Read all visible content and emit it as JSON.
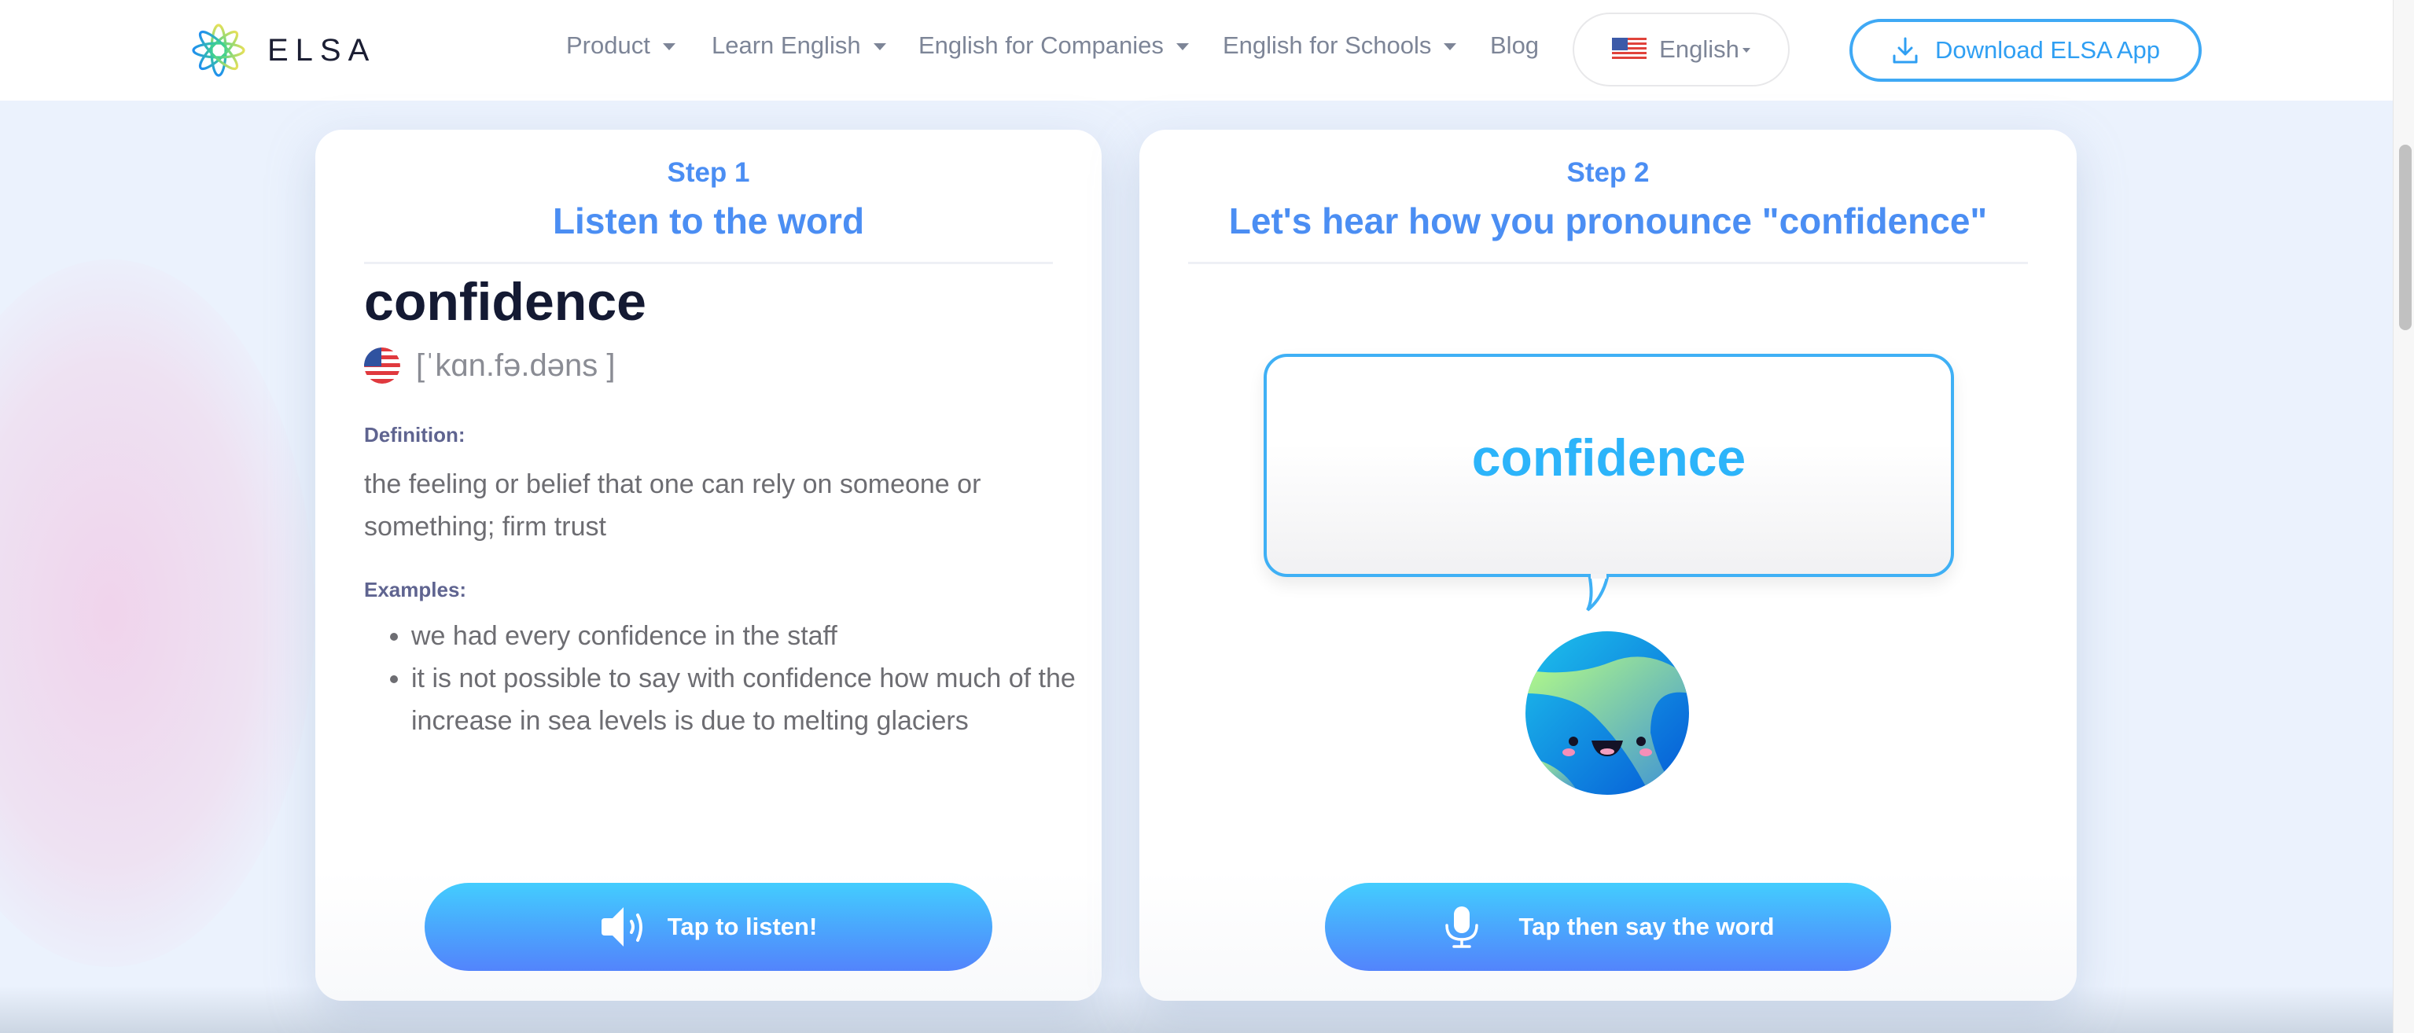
{
  "nav": {
    "brand": "ELSA",
    "items": [
      {
        "label": "Product",
        "has_dropdown": true
      },
      {
        "label": "Learn English",
        "has_dropdown": true
      },
      {
        "label": "English for Companies",
        "has_dropdown": true
      },
      {
        "label": "English for Schools",
        "has_dropdown": true
      },
      {
        "label": "Blog",
        "has_dropdown": false
      }
    ],
    "language": {
      "label": "English",
      "icon": "us-flag-icon"
    },
    "download": {
      "label": "Download ELSA App",
      "icon": "download-icon"
    }
  },
  "step1": {
    "step_label": "Step 1",
    "title": "Listen to the word",
    "word": "confidence",
    "phonetic": "[ˈkɑn.fə.dəns ]",
    "accent_icon": "us-flag-icon",
    "definition_label": "Definition:",
    "definition": "the feeling or belief that one can rely on someone or something; firm trust",
    "examples_label": "Examples:",
    "examples": [
      "we had every confidence in the staff",
      "it is not possible to say with confidence how much of the increase in sea levels is due to melting glaciers"
    ],
    "button": {
      "label": "Tap to listen!",
      "icon": "speaker-icon"
    }
  },
  "step2": {
    "step_label": "Step 2",
    "title": "Let's hear how you pronounce \"confidence\"",
    "bubble_word": "confidence",
    "mascot": "planet-mascot",
    "button": {
      "label": "Tap then say the word",
      "icon": "microphone-icon"
    }
  },
  "colors": {
    "accent": "#4b8ef3",
    "link_blue": "#2f9ff3",
    "button_top": "#43cdfe",
    "button_bottom": "#5384fc",
    "word_dark": "#141a33",
    "label": "#5f6490"
  }
}
